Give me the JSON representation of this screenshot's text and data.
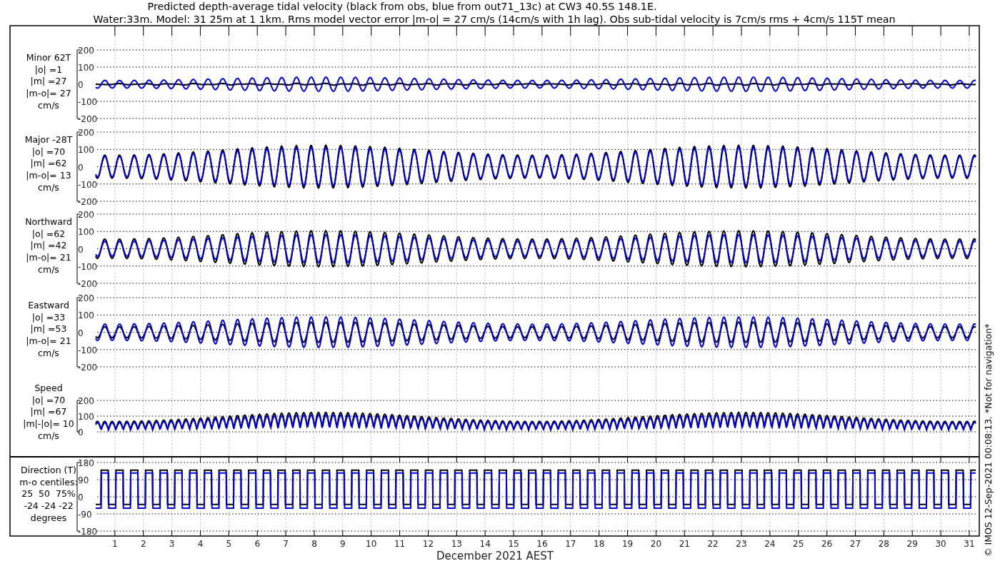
{
  "title_lines": [
    "Predicted depth-average tidal velocity (black from obs, blue from out71_13c) at CW3 40.5S 148.1E.",
    "Water:33m. Model: 31 25m at 1 1km. Rms model vector error |m-o| = 27 cm/s (14cm/s with 1h lag). Obs sub-tidal velocity is 7cm/s rms + 4cm/s 115T mean"
  ],
  "panels": [
    {
      "kind": "velocity",
      "label_lines": [
        "Minor 62T",
        "|o| =1",
        "|m| =27",
        "|m-o|= 27",
        "cm/s"
      ],
      "yticks": [
        "200",
        "100",
        "0",
        "-100",
        "-200"
      ]
    },
    {
      "kind": "velocity",
      "label_lines": [
        "Major -28T",
        "|o| =70",
        "|m| =62",
        "|m-o|= 13",
        "cm/s"
      ],
      "yticks": [
        "200",
        "100",
        "0",
        "-100",
        "-200"
      ]
    },
    {
      "kind": "velocity",
      "label_lines": [
        "Northward",
        "|o| =62",
        "|m| =42",
        "|m-o|= 21",
        "cm/s"
      ],
      "yticks": [
        "200",
        "100",
        "0",
        "-100",
        "-200"
      ]
    },
    {
      "kind": "velocity",
      "label_lines": [
        "Eastward",
        "|o| =33",
        "|m| =53",
        "|m-o|= 21",
        "cm/s"
      ],
      "yticks": [
        "200",
        "100",
        "0",
        "-100",
        "-200"
      ]
    },
    {
      "kind": "speed",
      "label_lines": [
        "Speed",
        "|o| =70",
        "|m| =67",
        "|m|-|o|= 10",
        "cm/s"
      ],
      "yticks": [
        "200",
        "100",
        "0"
      ]
    },
    {
      "kind": "direction",
      "label_lines": [
        "Direction (T)",
        "m-o centiles:",
        "25  50  75%",
        "-24 -24 -22",
        "degrees"
      ],
      "yticks": [
        "180",
        "90",
        "0",
        "-90",
        "-180"
      ]
    }
  ],
  "xticks": [
    "1",
    "2",
    "3",
    "4",
    "5",
    "6",
    "7",
    "8",
    "9",
    "10",
    "11",
    "12",
    "13",
    "14",
    "15",
    "16",
    "17",
    "18",
    "19",
    "20",
    "21",
    "22",
    "23",
    "24",
    "25",
    "26",
    "27",
    "28",
    "29",
    "30",
    "31"
  ],
  "xlabel": "December 2021 AEST",
  "footer": "© IMOS 12-Sep-2021 00:08:13. *Not for navigation*"
}
